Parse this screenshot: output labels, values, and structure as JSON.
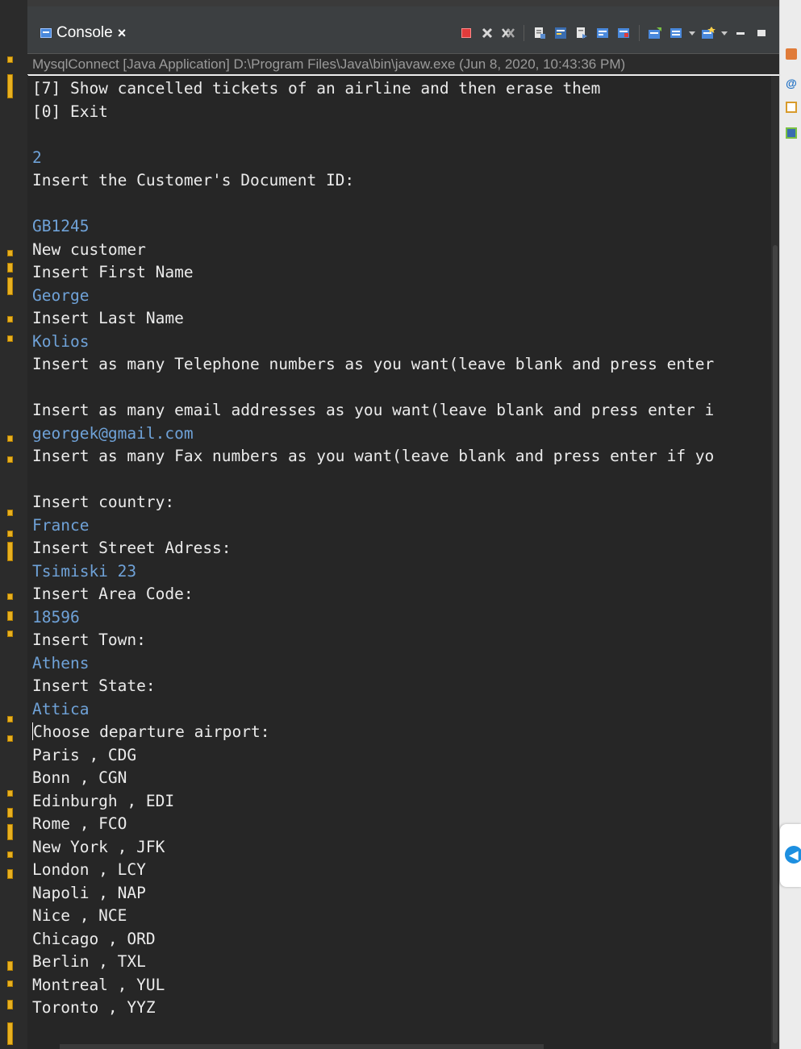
{
  "tab": {
    "label": "Console",
    "close_symbol": "×",
    "icon": "console-icon"
  },
  "toolbar": {
    "buttons": [
      {
        "name": "terminate-button",
        "icon": "stop-icon"
      },
      {
        "name": "remove-launch-button",
        "icon": "remove-icon"
      },
      {
        "name": "remove-all-terminated-button",
        "icon": "remove-all-icon"
      },
      {
        "name": "scroll-lock-button",
        "icon": "scroll-lock-icon"
      },
      {
        "name": "word-wrap-button",
        "icon": "word-wrap-icon"
      },
      {
        "name": "show-console-on-stdout-button",
        "icon": "stdout-icon"
      },
      {
        "name": "show-console-on-stderr-button",
        "icon": "stderr-icon"
      },
      {
        "name": "pin-console-button",
        "icon": "pin-icon"
      },
      {
        "name": "display-selected-console-button",
        "icon": "display-console-icon"
      },
      {
        "name": "open-console-button",
        "icon": "open-console-icon"
      },
      {
        "name": "minimize-button",
        "icon": "minimize-icon"
      },
      {
        "name": "maximize-button",
        "icon": "maximize-icon"
      }
    ]
  },
  "console": {
    "header": "MysqlConnect [Java Application] D:\\Program Files\\Java\\bin\\javaw.exe (Jun 8, 2020, 10:43:36 PM)",
    "lines": [
      {
        "text": "[7] Show cancelled tickets of an airline and then erase them",
        "kind": "out"
      },
      {
        "text": "[0] Exit",
        "kind": "out"
      },
      {
        "text": "",
        "kind": "out"
      },
      {
        "text": "2",
        "kind": "in"
      },
      {
        "text": "Insert the Customer's Document ID:",
        "kind": "out"
      },
      {
        "text": "",
        "kind": "out"
      },
      {
        "text": "GB1245",
        "kind": "in"
      },
      {
        "text": "New customer",
        "kind": "out"
      },
      {
        "text": "Insert First Name",
        "kind": "out"
      },
      {
        "text": "George",
        "kind": "in"
      },
      {
        "text": "Insert Last Name",
        "kind": "out"
      },
      {
        "text": "Kolios",
        "kind": "in"
      },
      {
        "text": "Insert as many Telephone numbers as you want(leave blank and press enter",
        "kind": "out"
      },
      {
        "text": "",
        "kind": "out"
      },
      {
        "text": "Insert as many email addresses as you want(leave blank and press enter i",
        "kind": "out"
      },
      {
        "text": "georgek@gmail.com",
        "kind": "in"
      },
      {
        "text": "Insert as many Fax numbers as you want(leave blank and press enter if yo",
        "kind": "out"
      },
      {
        "text": "",
        "kind": "out"
      },
      {
        "text": "Insert country:",
        "kind": "out"
      },
      {
        "text": "France",
        "kind": "in"
      },
      {
        "text": "Insert Street Adress:",
        "kind": "out"
      },
      {
        "text": "Tsimiski 23",
        "kind": "in"
      },
      {
        "text": "Insert Area Code:",
        "kind": "out"
      },
      {
        "text": "18596",
        "kind": "in"
      },
      {
        "text": "Insert Town:",
        "kind": "out"
      },
      {
        "text": "Athens",
        "kind": "in"
      },
      {
        "text": "Insert State:",
        "kind": "out"
      },
      {
        "text": "Attica",
        "kind": "in"
      },
      {
        "text": "Choose departure airport:",
        "kind": "out",
        "cursor": true
      },
      {
        "text": "Paris , CDG",
        "kind": "out"
      },
      {
        "text": "Bonn , CGN",
        "kind": "out"
      },
      {
        "text": "Edinburgh , EDI",
        "kind": "out"
      },
      {
        "text": "Rome , FCO",
        "kind": "out"
      },
      {
        "text": "New York , JFK",
        "kind": "out"
      },
      {
        "text": "London , LCY",
        "kind": "out"
      },
      {
        "text": "Napoli , NAP",
        "kind": "out"
      },
      {
        "text": "Nice , NCE",
        "kind": "out"
      },
      {
        "text": "Chicago , ORD",
        "kind": "out"
      },
      {
        "text": "Berlin , TXL",
        "kind": "out"
      },
      {
        "text": "Montreal , YUL",
        "kind": "out"
      },
      {
        "text": "Toronto , YYZ",
        "kind": "out"
      }
    ]
  },
  "colors": {
    "console_background": "#262626",
    "output_text": "#ebebeb",
    "input_text": "#6fa2d8",
    "tab_bar": "#3c3f41",
    "terminate_red": "#e23b3b"
  }
}
